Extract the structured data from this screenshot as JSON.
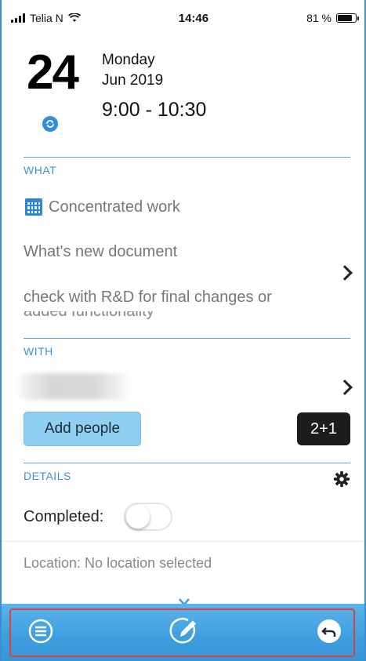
{
  "status_bar": {
    "carrier": "Telia N",
    "time": "14:46",
    "battery": "81 %",
    "battery_level": 0.81
  },
  "event": {
    "day": "24",
    "weekday": "Monday",
    "month_year": "Jun 2019",
    "time_range": "9:00 - 10:30"
  },
  "what": {
    "header": "WHAT",
    "category": "Concentrated work",
    "title": "What's new document",
    "note": "check with R&D for final changes or",
    "note_cut": "added functionality"
  },
  "with": {
    "header": "WITH",
    "add_people_label": "Add people",
    "count_badge": "2+1"
  },
  "details": {
    "header": "DETAILS",
    "completed_label": "Completed:",
    "completed": false,
    "location": "Location: No location selected"
  },
  "colors": {
    "accent": "#3b93cf",
    "toolbar": "#3d9ede",
    "highlight": "#d8433d"
  },
  "icons": {
    "menu": "menu-icon",
    "edit": "edit-icon",
    "back": "back-icon",
    "settings": "gear-icon",
    "sync": "sync-icon",
    "calendar": "calendar-icon"
  }
}
